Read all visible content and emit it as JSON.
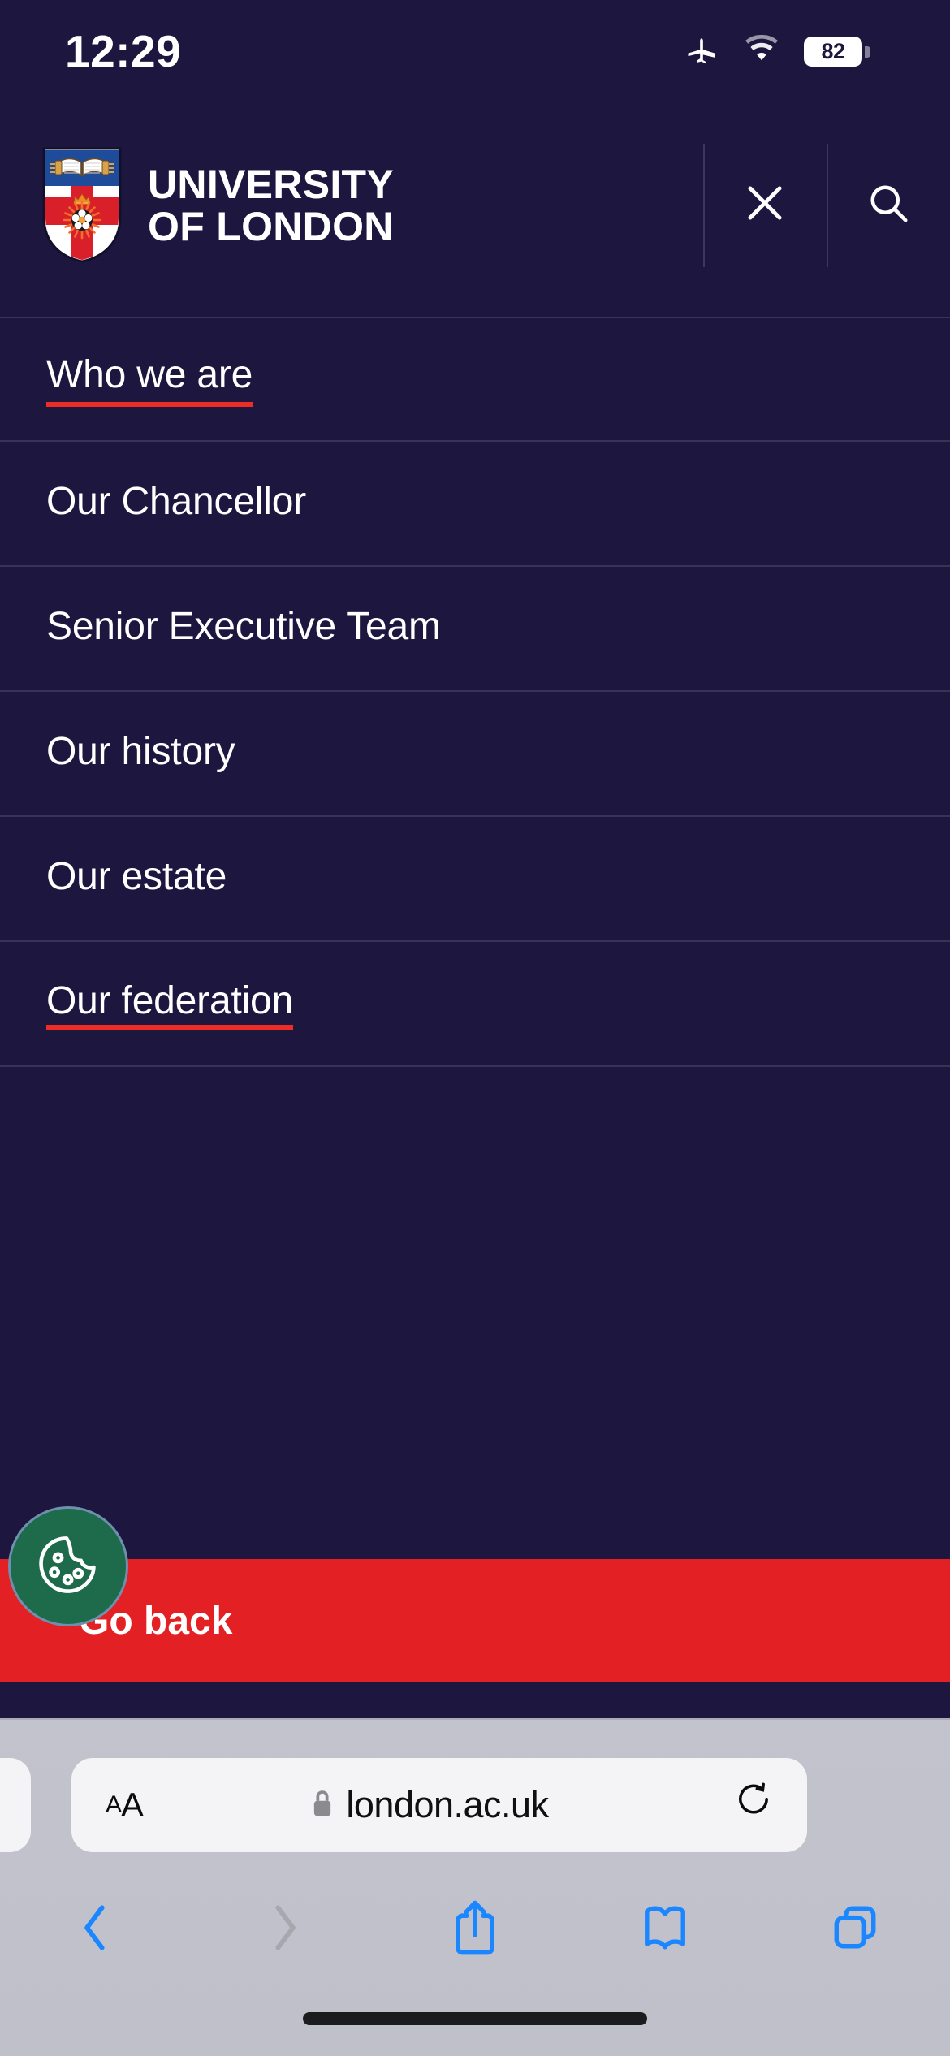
{
  "status_bar": {
    "time": "12:29",
    "airplane_icon": "airplane-icon",
    "wifi_icon": "wifi-icon",
    "battery_level": "82"
  },
  "site_header": {
    "logo_icon": "university-of-london-crest-icon",
    "brand_line1": "UNIVERSITY",
    "brand_line2": "OF LONDON",
    "close_icon": "close-icon",
    "search_icon": "search-icon"
  },
  "nav": {
    "items": [
      {
        "label": "Who we are",
        "active": true
      },
      {
        "label": "Our Chancellor",
        "active": false
      },
      {
        "label": "Senior Executive Team",
        "active": false
      },
      {
        "label": "Our history",
        "active": false
      },
      {
        "label": "Our estate",
        "active": false
      },
      {
        "label": "Our federation",
        "active": true
      }
    ]
  },
  "go_back": {
    "label": "Go back",
    "bar_color": "#e32124"
  },
  "cookie_widget": {
    "icon": "cookie-icon",
    "circle_color": "#1d6b4a"
  },
  "browser": {
    "text_size_small": "A",
    "text_size_big": "A",
    "lock_icon": "lock-icon",
    "url": "london.ac.uk",
    "reload_icon": "reload-icon",
    "toolbar": {
      "back_icon": "chevron-left-icon",
      "forward_icon": "chevron-right-icon",
      "share_icon": "share-icon",
      "bookmarks_icon": "book-icon",
      "tabs_icon": "tabs-icon"
    }
  },
  "theme": {
    "background": "#1d1740",
    "accent_red": "#ee2c26",
    "text": "#ffffff",
    "safari_blue": "#1a86ff"
  }
}
